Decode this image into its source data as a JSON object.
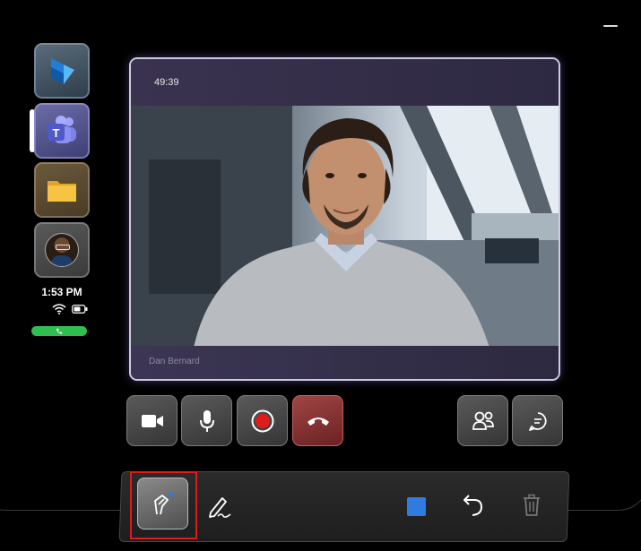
{
  "dock": {
    "apps": [
      {
        "name": "Dynamics 365 Guides",
        "icon": "dynamics-icon"
      },
      {
        "name": "Microsoft Teams",
        "icon": "teams-icon",
        "active": true
      },
      {
        "name": "Files",
        "icon": "folder-icon"
      },
      {
        "name": "Contact",
        "icon": "avatar"
      }
    ],
    "time": "1:53 PM",
    "status_icons": [
      "wifi-icon",
      "battery-icon"
    ],
    "call_indicator_icon": "phone-icon",
    "call_indicator_color": "#2fbf4f"
  },
  "call": {
    "timer": "49:39",
    "participant_name": "Dan Bernard"
  },
  "controls": [
    {
      "name": "camera",
      "icon": "video-camera-icon"
    },
    {
      "name": "microphone",
      "icon": "microphone-icon"
    },
    {
      "name": "record",
      "icon": "record-icon",
      "color": "#e01b1b"
    },
    {
      "name": "hang-up",
      "icon": "hang-up-icon",
      "color": "#8a3030"
    },
    {
      "name": "participants",
      "icon": "participants-icon"
    },
    {
      "name": "chat",
      "icon": "chat-icon"
    }
  ],
  "annotation_toolbar": {
    "tools": [
      {
        "name": "ink-pen",
        "icon": "ink-pen-icon",
        "selected": true
      },
      {
        "name": "pencil",
        "icon": "pencil-icon"
      },
      {
        "name": "color",
        "icon": "color-swatch",
        "color": "#2f7be0"
      },
      {
        "name": "undo",
        "icon": "undo-icon"
      },
      {
        "name": "delete",
        "icon": "trash-icon",
        "disabled": true
      }
    ],
    "highlight_color": "#e01a1a"
  }
}
